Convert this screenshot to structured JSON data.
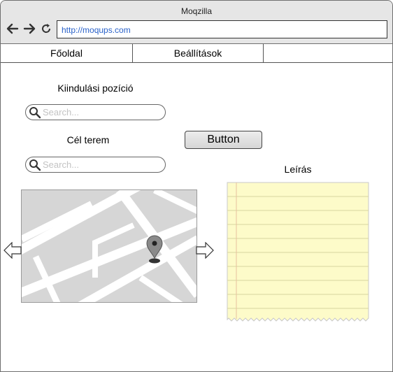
{
  "browser": {
    "title": "Moqzilla",
    "url": "http://moqups.com",
    "icons": [
      "back-arrow-icon",
      "forward-arrow-icon",
      "reload-icon"
    ]
  },
  "tabs": [
    {
      "label": "Főoldal"
    },
    {
      "label": "Beállítások"
    },
    {
      "label": ""
    }
  ],
  "form": {
    "start_label": "Kiindulási pozíció",
    "start_search_placeholder": "Search...",
    "target_label": "Cél terem",
    "target_search_placeholder": "Search...",
    "button_label": "Button"
  },
  "map": {
    "icons": [
      "map-pin-icon",
      "left-arrow-icon",
      "right-arrow-icon"
    ]
  },
  "description": {
    "label": "Leírás",
    "text": ""
  },
  "colors": {
    "url": "#2a62c9",
    "notes_bg": "#fdfbc9",
    "notes_line": "#d8d4a0",
    "map_bg": "#d6d6d6",
    "map_road": "#ffffff",
    "chrome": "#e6e6e6"
  }
}
